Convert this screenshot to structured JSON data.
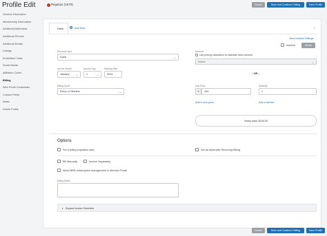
{
  "header": {
    "title": "Profile Edit",
    "member_name": "Pegasus (1570)",
    "buttons": {
      "cancel": "Cancel",
      "save_continue": "Save and Continue Editing",
      "save_profile": "Save Profile"
    }
  },
  "sidebar": {
    "items": [
      {
        "label": "General Information"
      },
      {
        "label": "Membership Information"
      },
      {
        "label": "Additional Addresses"
      },
      {
        "label": "Additional Phones"
      },
      {
        "label": "Additional Emails"
      },
      {
        "label": "Listings"
      },
      {
        "label": "Embedded Video"
      },
      {
        "label": "Social Media"
      },
      {
        "label": "Affiliation Codes"
      },
      {
        "label": "Billing"
      },
      {
        "label": "Web Portal Credentials"
      },
      {
        "label": "Custom Fields"
      },
      {
        "label": "Notes"
      },
      {
        "label": "Delete Profile"
      }
    ],
    "active": "Billing"
  },
  "tabs": {
    "dues": "Dues",
    "add_new": "Add New",
    "collapse_icon": "chevron-right"
  },
  "links": {
    "view_inactive": "View Inactive Billings",
    "add_new_price": "Add a new price",
    "add_flat_fee": "Add a flat fee"
  },
  "buttons": {
    "inactive": "Inactive",
    "delete": "Delete"
  },
  "form": {
    "revenue_item": {
      "label": "Revenue Item",
      "value": "Dues"
    },
    "amount": {
      "label": "Amount",
      "checkbox_label": "Use pricing calculation to calculate dues amount",
      "select_value": "Select"
    },
    "or_text": "- OR -",
    "anchor_month": {
      "label": "Anchor Month",
      "value": "January"
    },
    "anchor_day": {
      "label": "Anchor Day",
      "value": "1"
    },
    "starting_year": {
      "label": "Starting Year",
      "value": "2024"
    },
    "billing_cycle": {
      "label": "Billing Cycle",
      "value": "Every 12 Months"
    },
    "unit_price": {
      "label": "Unit Price",
      "prefix": "$",
      "value": "100"
    },
    "quantity": {
      "label": "Quantity",
      "value": "1"
    },
    "yearly_total": "Yearly total: $100.00"
  },
  "options": {
    "title": "Options",
    "set_expiration": "Set a billing expiration date",
    "set_auto_billing": "Set as Automatic Recurring Billing",
    "bill_manually": "Bill Manually",
    "invoice_separately": "Invoice Separately",
    "allow_mbr": "Allow MBR subscription management in Member Portal",
    "billing_notes": "Billing Notes",
    "expand_overrides": "Expand Invoice Overrides"
  },
  "colors": {
    "accent": "#1f6fb5",
    "button_gray": "#9aa0a6",
    "logo": "#c0392b"
  }
}
